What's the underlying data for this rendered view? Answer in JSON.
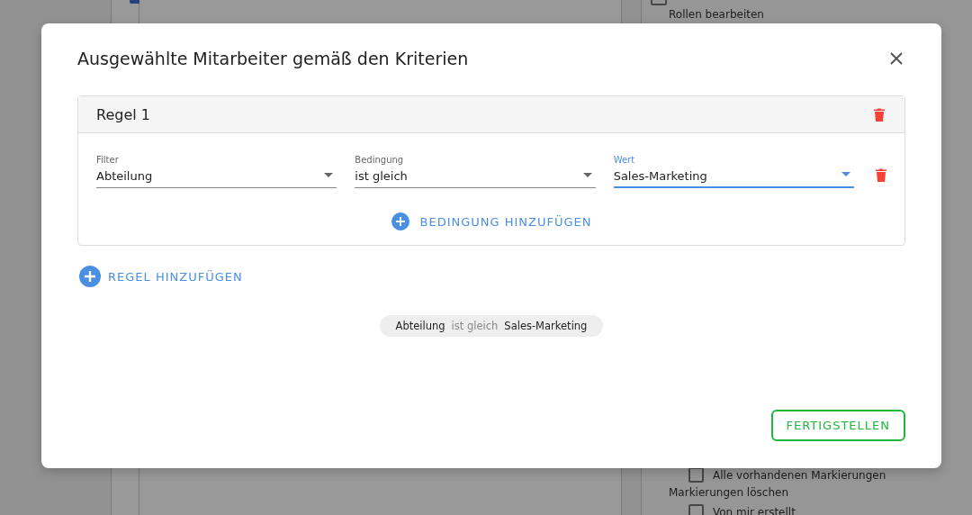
{
  "background": {
    "top_checkboxes": [
      {
        "checked": true
      },
      {
        "checked": false
      }
    ],
    "items": [
      {
        "kind": "heading",
        "text": "Rollen bearbeiten"
      },
      {
        "kind": "checkbox",
        "text": "Alle vorhandenen Markierungen",
        "checked": false
      },
      {
        "kind": "heading",
        "text": "Markierungen löschen"
      },
      {
        "kind": "checkbox",
        "text": "Von mir erstellt",
        "checked": false
      }
    ]
  },
  "dialog": {
    "title": "Ausgewählte Mitarbeiter gemäß den Kriterien",
    "rules": [
      {
        "title": "Regel 1",
        "conditions": [
          {
            "fields": [
              {
                "label": "Filter",
                "value": "Abteilung",
                "focused": false
              },
              {
                "label": "Bedingung",
                "value": "ist gleich",
                "focused": false
              },
              {
                "label": "Wert",
                "value": "Sales-Marketing",
                "focused": true
              }
            ]
          }
        ],
        "add_condition": "BEDINGUNG HINZUFÜGEN"
      }
    ],
    "add_rule": "REGEL HINZUFÜGEN",
    "summary": [
      {
        "kind": "field",
        "text": "Abteilung"
      },
      {
        "kind": "operator",
        "text": "ist gleich"
      },
      {
        "kind": "value",
        "text": "Sales-Marketing"
      }
    ],
    "done_button": "FERTIGSTELLEN"
  }
}
